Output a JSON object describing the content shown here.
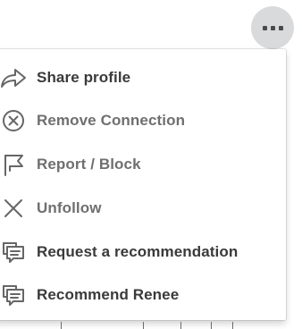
{
  "more_button": {
    "icon": "more-horizontal-icon",
    "color": "#d9dadc"
  },
  "menu": {
    "items": [
      {
        "label": "Share profile",
        "icon": "share-arrow-icon",
        "style": "dark"
      },
      {
        "label": "Remove Connection",
        "icon": "remove-circle-icon",
        "style": "muted"
      },
      {
        "label": "Report / Block",
        "icon": "flag-icon",
        "style": "muted"
      },
      {
        "label": "Unfollow",
        "icon": "close-icon",
        "style": "muted"
      },
      {
        "label": "Request a recommendation",
        "icon": "chat-bubbles-icon",
        "style": "dark"
      },
      {
        "label": "Recommend Renee",
        "icon": "chat-bubbles-icon",
        "style": "dark"
      }
    ]
  },
  "colors": {
    "text_dark": "#3a3a3a",
    "text_muted": "#6f6f6f",
    "icon": "#666666"
  }
}
